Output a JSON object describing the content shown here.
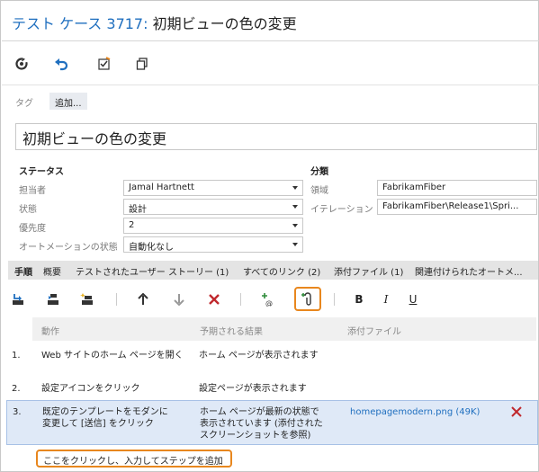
{
  "header": {
    "type_label": "テスト ケース",
    "id": "3717:",
    "title": "初期ビューの色の変更"
  },
  "toolbar": {
    "icons": [
      "refresh-icon",
      "undo-icon",
      "edit-checklist-icon",
      "copy-icon"
    ]
  },
  "tags": {
    "label": "タグ",
    "add_label": "追加..."
  },
  "title_field": {
    "value": "初期ビューの色の変更"
  },
  "status_section": {
    "heading": "ステータス",
    "assigned_to": {
      "label": "担当者",
      "value": "Jamal Hartnett"
    },
    "state": {
      "label": "状態",
      "value": "設計"
    },
    "priority": {
      "label": "優先度",
      "value": "2"
    },
    "automation_status": {
      "label": "オートメーションの状態",
      "value": "自動化なし"
    }
  },
  "classification_section": {
    "heading": "分類",
    "area": {
      "label": "領域",
      "value": "FabrikamFiber"
    },
    "iteration": {
      "label": "イテレーション",
      "value": "FabrikamFiber\\Release1\\Spri..."
    }
  },
  "tabs": [
    {
      "label": "手順"
    },
    {
      "label": "概要"
    },
    {
      "label": "テストされたユーザー ストーリー (1)"
    },
    {
      "label": "すべてのリンク (2)"
    },
    {
      "label": "添付ファイル (1)"
    },
    {
      "label": "関連付けられたオートメ..."
    }
  ],
  "steps_toolbar": {
    "bold": "B",
    "italic": "I",
    "underline": "U"
  },
  "steps_grid": {
    "columns": {
      "action": "動作",
      "expected": "予期される結果",
      "attachments": "添付ファイル"
    },
    "rows": [
      {
        "num": "1.",
        "action": [
          "Web サイトのホーム ページを開く"
        ],
        "expected": [
          "ホーム ページが表示されます"
        ],
        "attachment": ""
      },
      {
        "num": "2.",
        "action": [
          "設定アイコンをクリック"
        ],
        "expected": [
          "設定ページが表示されます"
        ],
        "attachment": ""
      },
      {
        "num": "3.",
        "action": [
          "既定のテンプレートをモダンに",
          "変更して [送信] をクリック"
        ],
        "expected": [
          "ホーム ページが最新の状態で",
          "表示されています (添付された",
          "スクリーンショットを参照)"
        ],
        "attachment": "homepagemodern.png (49K)"
      }
    ],
    "add_step_label": "ここをクリックし、入力してステップを追加"
  },
  "colors": {
    "accent_blue": "#1f6fbf",
    "highlight_orange": "#e8871e",
    "delete_red": "#c0282d",
    "selected_row": "#dfe9f7"
  }
}
